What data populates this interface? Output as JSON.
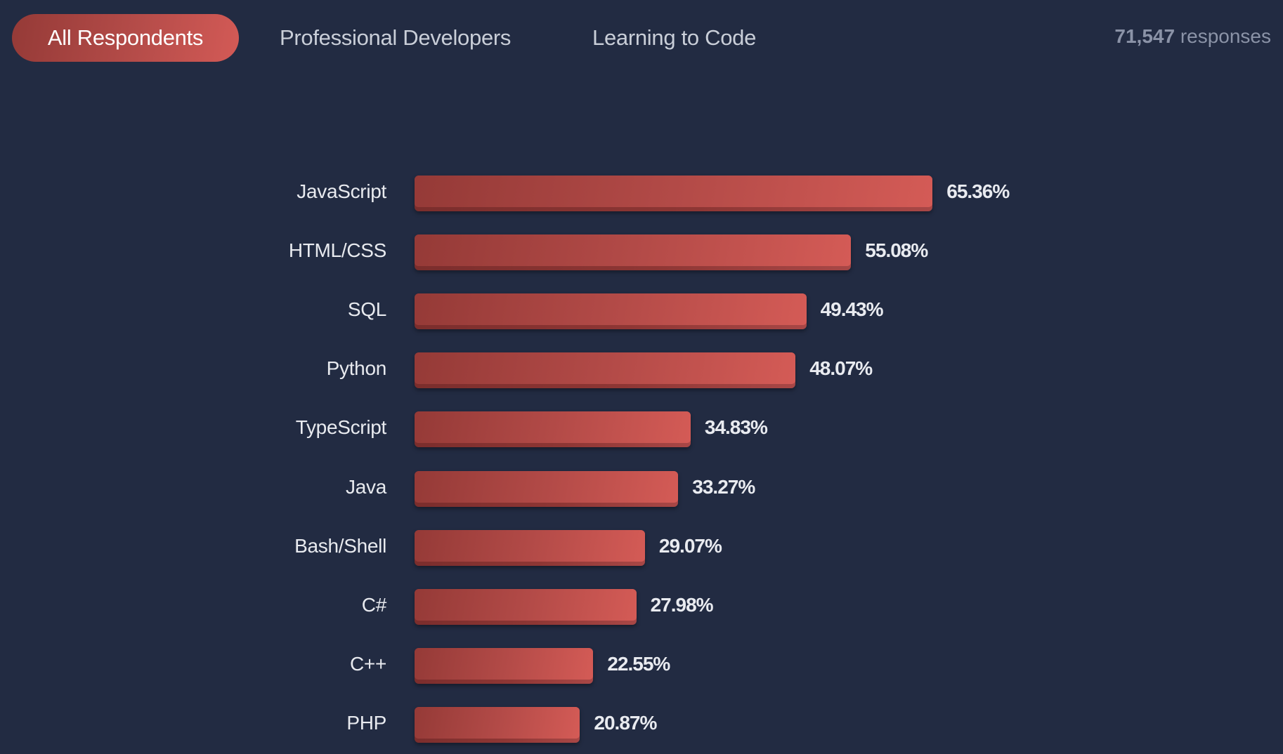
{
  "tabs": [
    {
      "label": "All Respondents",
      "active": true
    },
    {
      "label": "Professional Developers",
      "active": false
    },
    {
      "label": "Learning to Code",
      "active": false
    }
  ],
  "responses": {
    "count": "71,547",
    "suffix": "responses"
  },
  "colors": {
    "background": "#222b42",
    "accent_start": "#953a37",
    "accent_end": "#d45b56",
    "label_text": "#e8eaef",
    "muted_text": "#8b93a7"
  },
  "chart_data": {
    "type": "bar",
    "orientation": "horizontal",
    "title": "",
    "xlabel": "",
    "ylabel": "",
    "xlim": [
      0,
      100
    ],
    "grid": false,
    "legend": "none",
    "unit": "%",
    "categories": [
      "JavaScript",
      "HTML/CSS",
      "SQL",
      "Python",
      "TypeScript",
      "Java",
      "Bash/Shell",
      "C#",
      "C++",
      "PHP"
    ],
    "values": [
      65.36,
      55.08,
      49.43,
      48.07,
      34.83,
      33.27,
      29.07,
      27.98,
      22.55,
      20.87
    ],
    "value_labels": [
      "65.36%",
      "55.08%",
      "49.43%",
      "48.07%",
      "34.83%",
      "33.27%",
      "29.07%",
      "27.98%",
      "22.55%",
      "20.87%"
    ]
  }
}
